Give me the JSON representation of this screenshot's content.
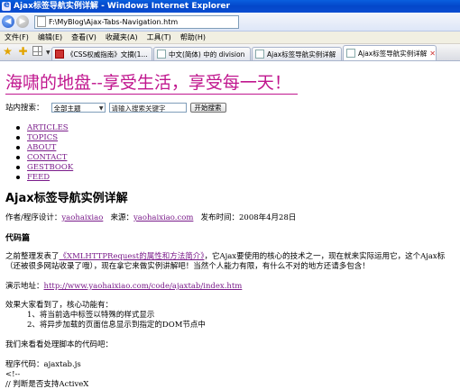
{
  "window": {
    "title": "Ajax标签导航实例详解 - Windows Internet Explorer"
  },
  "address": {
    "url": "F:\\MyBlog\\Ajax-Tabs-Navigation.htm"
  },
  "menu": {
    "items": [
      "文件(F)",
      "编辑(E)",
      "查看(V)",
      "收藏夹(A)",
      "工具(T)",
      "帮助(H)"
    ]
  },
  "tabs": [
    {
      "label": "《CSS权威指南》文摘(1...",
      "favicon": "page-icon",
      "active": false
    },
    {
      "label": "中文(简体) 中的 division",
      "favicon": "page-icon",
      "active": false
    },
    {
      "label": "Ajax标签导航实例详解",
      "favicon": "page-icon",
      "active": false
    },
    {
      "label": "Ajax标签导航实例详解",
      "favicon": "page-icon",
      "active": true
    }
  ],
  "page": {
    "site_title": "海啸的地盘--享受生活，享受每一天！",
    "search": {
      "label": "站内搜索：",
      "category": "全部主题",
      "placeholder": "请输入搜索关键字",
      "button": "开始搜索"
    },
    "nav": [
      "ARTICLES",
      "TOPICS",
      "ABOUT",
      "CONTACT",
      "GESTBOOK",
      "FEED"
    ],
    "article": {
      "title": "Ajax标签导航实例详解",
      "author_label": "作者/程序设计：",
      "author": "yaohaixiao",
      "source_label": "来源：",
      "source": "yaohaixiao.com",
      "date_label": "发布时间：",
      "date": "2008年4月28日"
    },
    "section_heading": "代码篇",
    "paragraph1_prefix": "之前整理发表了",
    "paragraph1_link": "《XMLHTTPRequest的属性和方法简介》",
    "paragraph1_suffix": "，它Ajax要使用的核心的技术之一，现在就来实际运用它，这个Ajax标",
    "paragraph1_line2": "（还被很多网站收录了哦），现在拿它来做实例讲解吧！当然个人能力有限，有什么不对的地方还请多包含！",
    "demo_label": "演示地址：",
    "demo_url": "http://www.yaohaixiao.com/code/ajaxtab/index.htm",
    "features_intro": "效果大家看到了，核心功能有：",
    "feature1": "1、将当前选中标签以特殊的样式显示",
    "feature2": "2、将异步加载的页面信息显示到指定的DOM节点中",
    "handler_intro": "我们来看看处理脚本的代码吧：",
    "code_label": "程序代码：ajaxtab.js",
    "code_line1": "<!--",
    "code_line2": "// 判断是否支持ActiveX"
  },
  "colors": {
    "site_title": "#c0168e",
    "link": "#7a1b8a",
    "titlebar": "#0a4ed2"
  }
}
